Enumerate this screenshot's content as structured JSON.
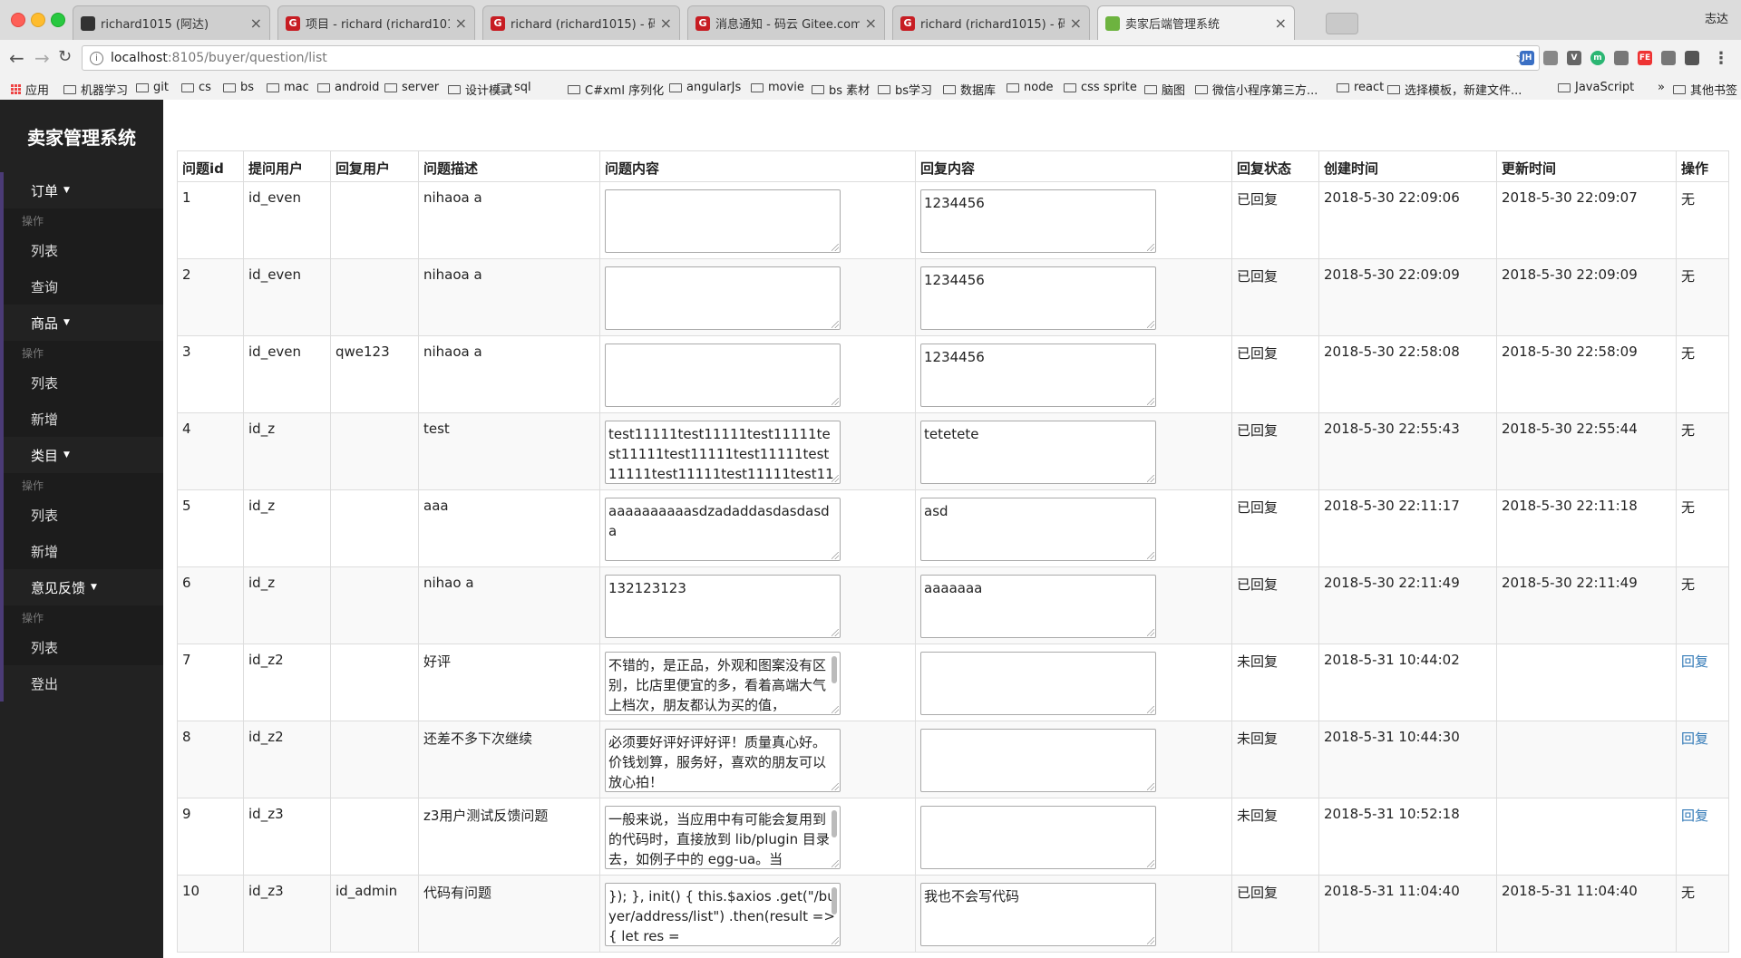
{
  "browser": {
    "tabs": [
      {
        "title": "richard1015 (阿达)",
        "icon": "github-icon",
        "color": "#333333"
      },
      {
        "title": "项目 - richard (richard1015) - 码",
        "icon": "gitee-icon",
        "color": "#c71d23"
      },
      {
        "title": "richard (richard1015) - 码云 Gi",
        "icon": "gitee-icon",
        "color": "#c71d23"
      },
      {
        "title": "消息通知 - 码云 Gitee.com",
        "icon": "gitee-icon",
        "color": "#c71d23"
      },
      {
        "title": "richard (richard1015) - 码云 Gi",
        "icon": "gitee-icon",
        "color": "#c71d23"
      },
      {
        "title": "卖家后端管理系统",
        "icon": "leaf-icon",
        "color": "#6db33f"
      }
    ],
    "profile_name": "志达",
    "url_host": "localhost",
    "url_path": ":8105/buyer/question/list",
    "bookmarks": [
      "应用",
      "机器学习",
      "git",
      "cs",
      "bs",
      "mac",
      "android",
      "server",
      "设计模式",
      "sql",
      "C#xml 序列化",
      "angularJs",
      "movie",
      "bs 素材",
      "bs学习",
      "数据库",
      "node",
      "css sprite",
      "脑图",
      "微信小程序第三方...",
      "react",
      "选择模板，新建文件...",
      "JavaScript"
    ],
    "bookmarks_more": "»",
    "other_bookmarks": "其他书签"
  },
  "sidebar": {
    "brand": "卖家管理系统",
    "groups": [
      {
        "title": "订单",
        "sub": "操作",
        "items": [
          "列表",
          "查询"
        ]
      },
      {
        "title": "商品",
        "sub": "操作",
        "items": [
          "列表",
          "新增"
        ]
      },
      {
        "title": "类目",
        "sub": "操作",
        "items": [
          "列表",
          "新增"
        ]
      },
      {
        "title": "意见反馈",
        "sub": "操作",
        "items": [
          "列表"
        ]
      }
    ],
    "logout": "登出"
  },
  "table": {
    "headers": [
      "问题id",
      "提问用户",
      "回复用户",
      "问题描述",
      "问题内容",
      "回复内容",
      "回复状态",
      "创建时间",
      "更新时间",
      "操作"
    ],
    "rows": [
      {
        "id": "1",
        "ask_user": "id_even",
        "reply_user": "",
        "desc": "nihaoa a",
        "content": "",
        "reply": "1234456",
        "status": "已回复",
        "created": "2018-5-30 22:09:06",
        "updated": "2018-5-30 22:09:07",
        "action": "无"
      },
      {
        "id": "2",
        "ask_user": "id_even",
        "reply_user": "",
        "desc": "nihaoa a",
        "content": "",
        "reply": "1234456",
        "status": "已回复",
        "created": "2018-5-30 22:09:09",
        "updated": "2018-5-30 22:09:09",
        "action": "无"
      },
      {
        "id": "3",
        "ask_user": "id_even",
        "reply_user": "qwe123",
        "desc": "nihaoa a",
        "content": "",
        "reply": "1234456",
        "status": "已回复",
        "created": "2018-5-30 22:58:08",
        "updated": "2018-5-30 22:58:09",
        "action": "无"
      },
      {
        "id": "4",
        "ask_user": "id_z",
        "reply_user": "",
        "desc": "test",
        "content": "test11111test11111test11111test11111test11111test11111test11111test11111test11111test11111",
        "reply": "tetetete",
        "status": "已回复",
        "created": "2018-5-30 22:55:43",
        "updated": "2018-5-30 22:55:44",
        "action": "无"
      },
      {
        "id": "5",
        "ask_user": "id_z",
        "reply_user": "",
        "desc": "aaa",
        "content": "aaaaaaaaaasdzadaddasdasdasda",
        "reply": "asd",
        "status": "已回复",
        "created": "2018-5-30 22:11:17",
        "updated": "2018-5-30 22:11:18",
        "action": "无"
      },
      {
        "id": "6",
        "ask_user": "id_z",
        "reply_user": "",
        "desc": "nihao a",
        "content": "132123123",
        "reply": "aaaaaaa",
        "status": "已回复",
        "created": "2018-5-30 22:11:49",
        "updated": "2018-5-30 22:11:49",
        "action": "无"
      },
      {
        "id": "7",
        "ask_user": "id_z2",
        "reply_user": "",
        "desc": "好评",
        "content": "不错的，是正品，外观和图案没有区别，比店里便宜的多，看着高端大气上档次，朋友都认为买的值，",
        "reply": "",
        "status": "未回复",
        "created": "2018-5-31 10:44:02",
        "updated": "",
        "action": "回复"
      },
      {
        "id": "8",
        "ask_user": "id_z2",
        "reply_user": "",
        "desc": "还差不多下次继续",
        "content": "必须要好评好评好评！质量真心好。价钱划算，服务好，喜欢的朋友可以放心拍！",
        "reply": "",
        "status": "未回复",
        "created": "2018-5-31 10:44:30",
        "updated": "",
        "action": "回复"
      },
      {
        "id": "9",
        "ask_user": "id_z3",
        "reply_user": "",
        "desc": "z3用户测试反馈问题",
        "content": "一般来说，当应用中有可能会复用到的代码时，直接放到 lib/plugin 目录去，如例子中的 egg-ua。当",
        "reply": "",
        "status": "未回复",
        "created": "2018-5-31 10:52:18",
        "updated": "",
        "action": "回复"
      },
      {
        "id": "10",
        "ask_user": "id_z3",
        "reply_user": "id_admin",
        "desc": "代码有问题",
        "content": "  });     },     init() {         this.$axios .get(\"/buyer/address/list\") .then(result => {           let res =",
        "reply": "我也不会写代码",
        "status": "已回复",
        "created": "2018-5-31 11:04:40",
        "updated": "2018-5-31 11:04:40",
        "action": "无"
      }
    ]
  }
}
